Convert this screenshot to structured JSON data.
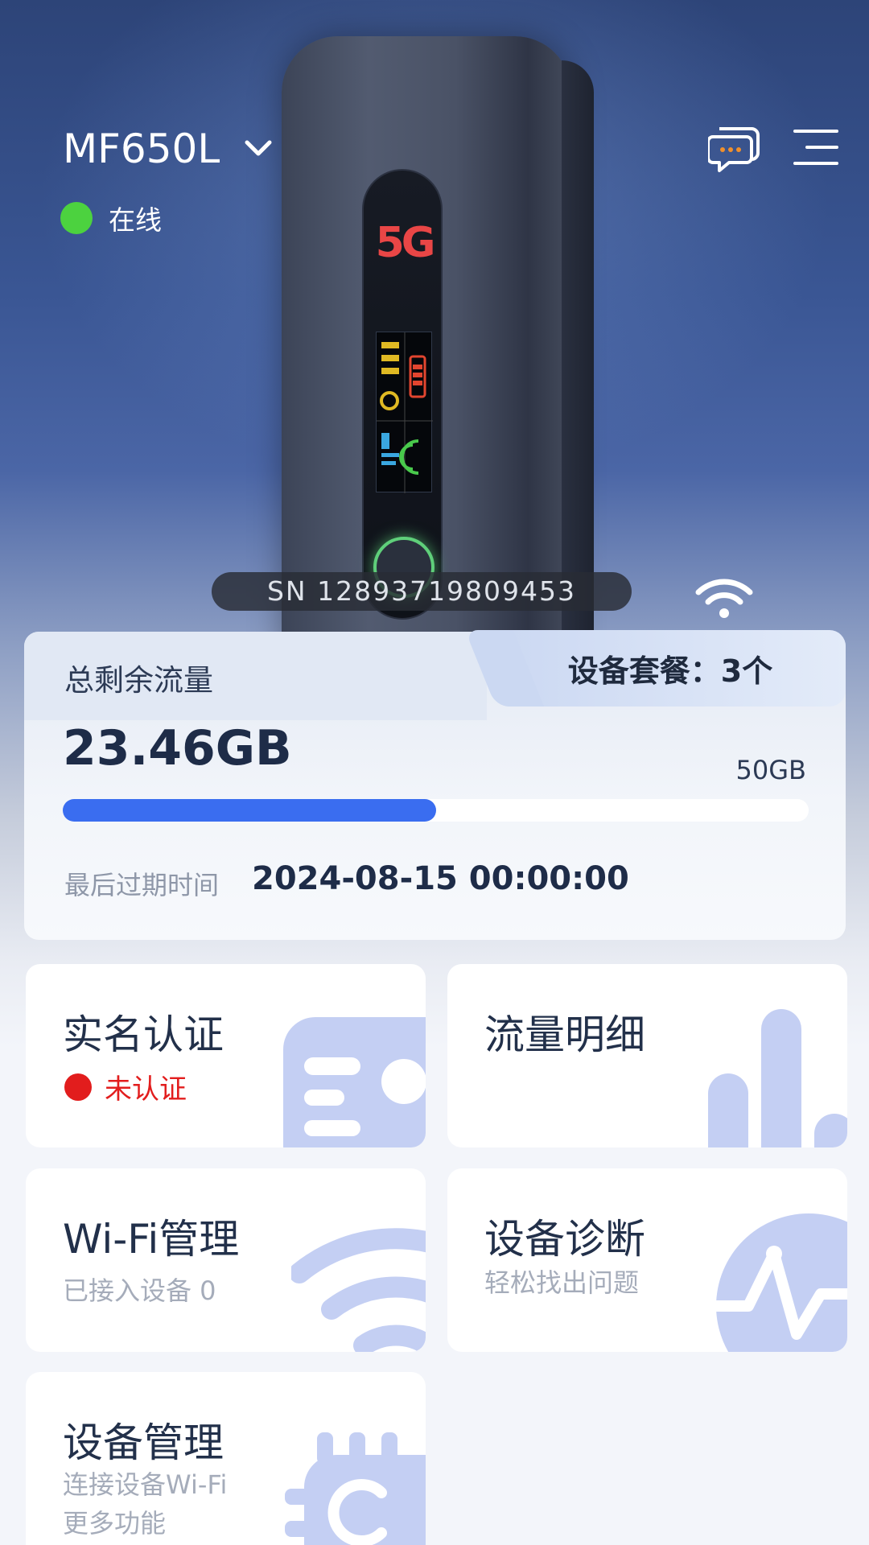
{
  "header": {
    "model": "MF650L",
    "status": "在线",
    "status_color": "#4cd23f"
  },
  "device": {
    "sn_label": "SN 12893719809453",
    "screen_badge": "5G"
  },
  "data_card": {
    "label": "总剩余流量",
    "remaining": "23.46GB",
    "total": "50GB",
    "progress_fraction": 0.5,
    "expire_label": "最后过期时间",
    "expire_value": "2024-08-15 00:00:00",
    "plan_tab": "设备套餐：3个",
    "accent_color": "#3a6df0"
  },
  "tiles": [
    {
      "title": "实名认证",
      "status": "未认证",
      "icon": "id-card-icon"
    },
    {
      "title": "流量明细",
      "icon": "bar-chart-icon"
    },
    {
      "title": "Wi-Fi管理",
      "sub": "已接入设备  0",
      "icon": "wifi-icon"
    },
    {
      "title": "设备诊断",
      "sub": "轻松找出问题",
      "icon": "pulse-icon"
    },
    {
      "title": "设备管理",
      "sub_line1": "连接设备Wi-Fi",
      "sub_line2": "更多功能",
      "icon": "chip-icon"
    }
  ]
}
